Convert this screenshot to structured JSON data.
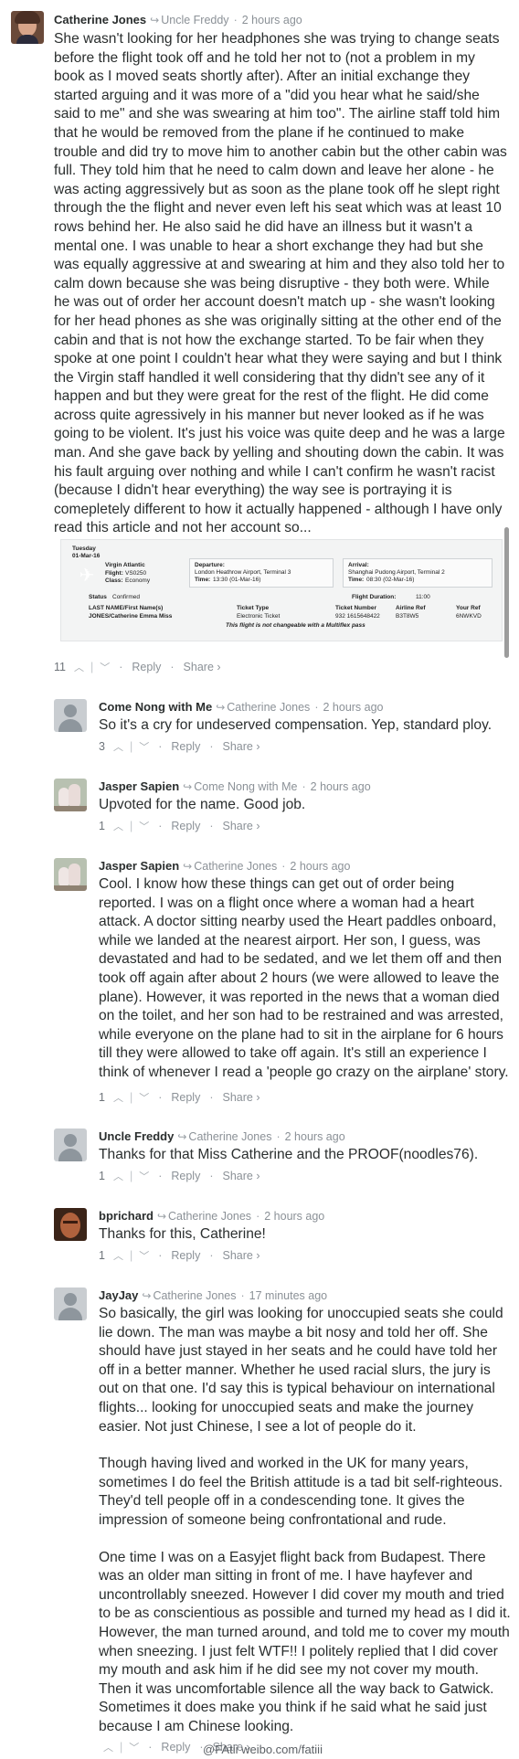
{
  "comments": [
    {
      "author": "Catherine Jones",
      "reply_to": "Uncle Freddy",
      "time": "2 hours ago",
      "paragraphs": [
        "She wasn't looking for her headphones she was trying to change seats before the flight took off and he told her not to (not a problem in my book as I moved seats shortly after). After an initial exchange they started arguing and it was more of a \"did you hear what he said/she said to me\" and she was swearing at him too\". The airline staff told him that he would be removed from the plane if he continued to make trouble and did try to move him to another cabin but the other cabin was full. They told him that he need to calm down and leave her alone - he was acting aggressively but as soon as the plane took off he slept right through the the flight and never even left his seat which was at least 10 rows behind her. He also said he did have an illness but it wasn't a mental one. I was unable to hear a short exchange they had but she was equally aggressive at and swearing at him and they also told her to calm down because she was being disruptive - they both were. While he was out of order her account doesn't match up - she wasn't looking for her head phones as she was originally sitting at the other end of the cabin and that is not how the exchange started. To be fair when they spoke at one point I couldn't hear what they were saying and but I think the Virgin staff handled it well considering that thy didn't see any of it happen and but they were great for the rest of the flight. He did come across quite agressively in his manner but never looked as if he was going to be violent. It's just his voice was quite deep and he was a large man. And she gave back by yelling and shouting down the cabin. It was his fault arguing over nothing and while I can't confirm he wasn't racist (because I didn't hear everything) the way see is portraying it is comepletely different to how it actually happened - although I have only read this article and not her account so..."
      ],
      "votes": "11",
      "reply_label": "Reply",
      "share_label": "Share ›"
    },
    {
      "author": "Come Nong with Me",
      "reply_to": "Catherine Jones",
      "time": "2 hours ago",
      "paragraphs": [
        "So it's a cry for undeserved compensation. Yep, standard ploy."
      ],
      "votes": "3",
      "reply_label": "Reply",
      "share_label": "Share ›"
    },
    {
      "author": "Jasper Sapien",
      "reply_to": "Come Nong with Me",
      "time": "2 hours ago",
      "paragraphs": [
        "Upvoted for the name. Good job."
      ],
      "votes": "1",
      "reply_label": "Reply",
      "share_label": "Share ›"
    },
    {
      "author": "Jasper Sapien",
      "reply_to": "Catherine Jones",
      "time": "2 hours ago",
      "paragraphs": [
        "Cool. I know how these things can get out of order being reported. I was on a flight once where a woman had a heart attack. A doctor sitting nearby used the Heart paddles onboard, while we landed at the nearest airport. Her son, I guess, was devastated and had to be sedated, and we let them off and then took off again after about 2 hours (we were allowed to leave the plane). However, it was reported in the news that a woman died on the toilet, and her son had to be restrained and was arrested, while everyone on the plane had to sit in the airplane for 6 hours till they were allowed to take off again. It's still an experience I think of whenever I read a 'people go crazy on the airplane' story."
      ],
      "votes": "1",
      "reply_label": "Reply",
      "share_label": "Share ›"
    },
    {
      "author": "Uncle Freddy",
      "reply_to": "Catherine Jones",
      "time": "2 hours ago",
      "paragraphs": [
        "Thanks for that Miss Catherine and the PROOF(noodles76)."
      ],
      "votes": "1",
      "reply_label": "Reply",
      "share_label": "Share ›"
    },
    {
      "author": "bprichard",
      "reply_to": "Catherine Jones",
      "time": "2 hours ago",
      "paragraphs": [
        "Thanks for this, Catherine!"
      ],
      "votes": "1",
      "reply_label": "Reply",
      "share_label": "Share ›"
    },
    {
      "author": "JayJay",
      "reply_to": "Catherine Jones",
      "time": "17 minutes ago",
      "paragraphs": [
        "So basically, the girl was looking for unoccupied seats she could lie down. The man was maybe a bit nosy and told her off. She should have just stayed in her seats and he could have told her off in a better manner. Whether he used racial slurs, the jury is out on that one. I'd say this is typical behaviour on international flights... looking for unoccupied seats and make the journey easier. Not just Chinese, I see a lot of people do it.",
        "Though having lived and worked in the UK for many years, sometimes I do feel the British attitude is a tad bit self-righteous. They'd tell people off in a condescending tone. It gives the impression of someone being confrontational and rude.",
        "One time I was on a Easyjet flight back from Budapest. There was an older man sitting in front of me. I have hayfever and uncontrollably sneezed. However I did cover my mouth and tried to be as conscientious as possible and turned my head as I did it. However, the man turned around, and told me to cover my mouth when sneezing. I just felt WTF!! I politely replied that I did cover my mouth and ask him if he did see my not cover my mouth. Then it was uncomfortable silence all the way back to Gatwick. Sometimes it does make you think if he said what he said just because I am Chinese looking."
      ],
      "votes": "",
      "reply_label": "Reply",
      "share_label": "Share ›"
    }
  ],
  "ticket": {
    "date_label": "Tuesday",
    "date": "01-Mar-16",
    "airline": "Virgin Atlantic",
    "flight_label": "Flight:",
    "flight": "VS0250",
    "class_label": "Class:",
    "class": "Economy",
    "departure_label": "Departure:",
    "departure_airport": "London Heathrow Airport, Terminal 3",
    "departure_time_label": "Time:",
    "departure_time": "13:30 (01-Mar-16)",
    "arrival_label": "Arrival:",
    "arrival_airport": "Shanghai Pudong Airport, Terminal 2",
    "arrival_time_label": "Time:",
    "arrival_time": "08:30 (02-Mar-16)",
    "status_label": "Status",
    "status": "Confirmed",
    "duration_label": "Flight Duration:",
    "duration": "11:00",
    "col_name": "LAST NAME/First Name(s)",
    "col_type": "Ticket Type",
    "col_number": "Ticket Number",
    "col_airline_ref": "Airline Ref",
    "col_your_ref": "Your Ref",
    "passenger": "JONES/Catherine Emma Miss",
    "ticket_type": "Electronic Ticket",
    "ticket_number": "932 1615648422",
    "airline_ref": "B3T8W5",
    "your_ref": "6NWKVD",
    "note": "This flight is not changeable with a Multiflex pass"
  },
  "watermark": "@FAtii weibo.com/fatiii"
}
